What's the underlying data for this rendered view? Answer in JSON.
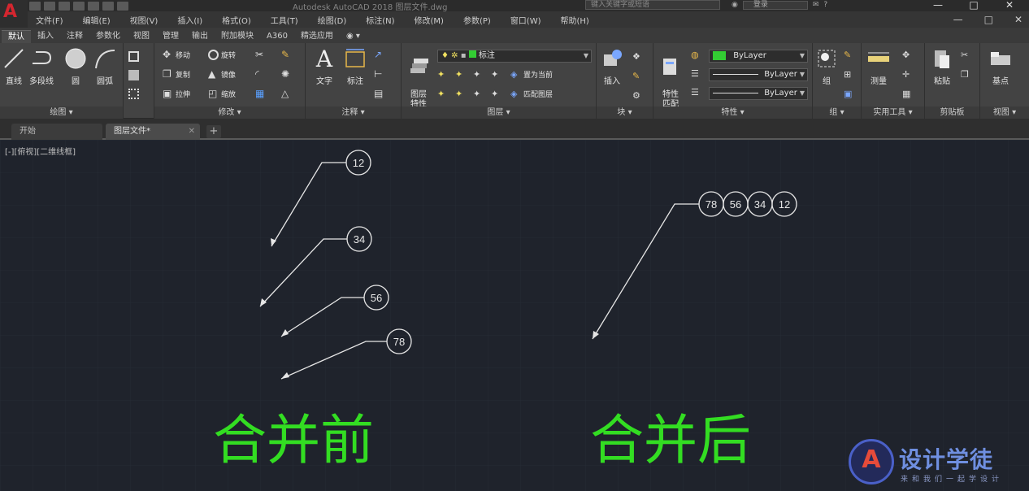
{
  "app": {
    "logo_letter": "A",
    "title": "Autodesk AutoCAD 2018    图层文件.dwg",
    "search_placeholder": "键入关键字或短语",
    "login_label": "登录",
    "window_controls": [
      "—",
      "□",
      "✕"
    ]
  },
  "menu": {
    "items": [
      "文件(F)",
      "编辑(E)",
      "视图(V)",
      "插入(I)",
      "格式(O)",
      "工具(T)",
      "绘图(D)",
      "标注(N)",
      "修改(M)",
      "参数(P)",
      "窗口(W)",
      "帮助(H)"
    ],
    "right_controls": [
      "—",
      "□",
      "✕"
    ]
  },
  "ribbon_tabs": [
    "默认",
    "插入",
    "注释",
    "参数化",
    "视图",
    "管理",
    "输出",
    "附加模块",
    "A360",
    "精选应用"
  ],
  "ribbon": {
    "draw": {
      "title": "绘图 ▾",
      "big": [
        "直线",
        "多段线",
        "圆",
        "圆弧"
      ]
    },
    "modify": {
      "title": "修改 ▾",
      "tools": [
        "移动",
        "旋转",
        "复制",
        "镜像",
        "拉伸",
        "缩放"
      ]
    },
    "annotation": {
      "title": "注释 ▾",
      "big": [
        "文字",
        "标注"
      ]
    },
    "layers": {
      "title": "图层 ▾",
      "big": "图层\n特性",
      "current_layer": "标注",
      "tools": [
        "置为当前",
        "匹配图层"
      ]
    },
    "block": {
      "title": "块 ▾",
      "big": "插入"
    },
    "properties": {
      "title": "特性 ▾",
      "big": "特性\n匹配",
      "color": "ByLayer",
      "linetype": "ByLayer",
      "lineweight": "ByLayer",
      "color_swatch": "#33cc33"
    },
    "groups": {
      "title": "组 ▾",
      "big": "组"
    },
    "utilities": {
      "title": "实用工具 ▾",
      "big": "测量"
    },
    "clipboard": {
      "title": "剪贴板",
      "big": "粘贴"
    },
    "view": {
      "title": "视图 ▾",
      "big": "基点"
    }
  },
  "doc_tabs": {
    "start": "开始",
    "active": "图层文件*",
    "add": "+"
  },
  "canvas": {
    "viewport_label": "[-][俯视][二维线框]",
    "balloons_before": [
      "12",
      "34",
      "56",
      "78"
    ],
    "balloons_after": [
      "78",
      "56",
      "34",
      "12"
    ],
    "label_before": "合并前",
    "label_after": "合并后",
    "text_color": "#33dd22",
    "line_color": "#e6e6e6"
  },
  "watermark": {
    "logo_letter": "A",
    "brand": "设计学徒",
    "tagline": "来和我们一起学设计"
  }
}
